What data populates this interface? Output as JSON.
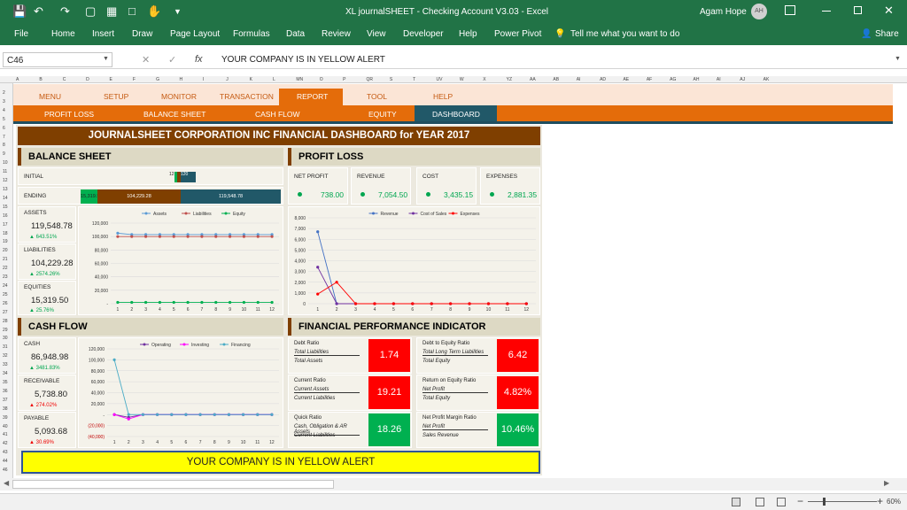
{
  "window": {
    "title": "XL journalSHEET - Checking Account V3.03  -  Excel",
    "user": "Agam Hope",
    "user_initials": "AH",
    "share": "Share"
  },
  "ribbon": {
    "tabs": [
      "File",
      "Home",
      "Insert",
      "Draw",
      "Page Layout",
      "Formulas",
      "Data",
      "Review",
      "View",
      "Developer",
      "Help",
      "Power Pivot"
    ],
    "tell_me": "Tell me what you want to do"
  },
  "formula": {
    "cell": "C46",
    "content": "YOUR COMPANY IS IN YELLOW ALERT"
  },
  "columns": [
    "A",
    "B",
    "C",
    "D",
    "E",
    "F",
    "G",
    "H",
    "I",
    "J",
    "K",
    "L",
    "MN",
    "O",
    "P",
    "QR",
    "S",
    "T",
    "UV",
    "W",
    "X",
    "YZ",
    "AA",
    "AB",
    "AI",
    "AD",
    "AE",
    "AF",
    "AG",
    "AH",
    "AI",
    "AJ",
    "AK"
  ],
  "rows": [
    "2",
    "3",
    "4",
    "5",
    "6",
    "7",
    "8",
    "9",
    "10",
    "11",
    "12",
    "13",
    "14",
    "15",
    "16",
    "17",
    "18",
    "19",
    "20",
    "21",
    "22",
    "23",
    "24",
    "25",
    "26",
    "27",
    "28",
    "29",
    "30",
    "31",
    "32",
    "33",
    "34",
    "35",
    "36",
    "37",
    "38",
    "39",
    "40",
    "41",
    "42",
    "43",
    "44",
    "46"
  ],
  "menu": [
    "MENU",
    "SETUP",
    "MONITOR",
    "TRANSACTION",
    "REPORT",
    "TOOL",
    "HELP"
  ],
  "submenu": [
    "PROFIT LOSS",
    "BALANCE SHEET",
    "CASH FLOW",
    "EQUITY",
    "DASHBOARD"
  ],
  "dashboard_title": "JOURNALSHEET CORPORATION INC FINANCIAL DASHBOARD  for YEAR 2017",
  "balance": {
    "title": "BALANCE SHEET",
    "initial_label": "INITIAL",
    "ending_label": "ENDING",
    "initial_bar_labels": [
      "12",
      "1",
      "2",
      "3",
      "120"
    ],
    "ending_bar_labels": [
      "15,319.50",
      "104,229.28",
      "119,548.78"
    ],
    "assets_label": "ASSETS",
    "assets_value": "119,548.78",
    "assets_pct": "▲ 643.51%",
    "liab_label": "LIABILITIES",
    "liab_value": "104,229.28",
    "liab_pct": "▲ 2574.26%",
    "eq_label": "EQUITIES",
    "eq_value": "15,319.50",
    "eq_pct": "▲ 25.76%"
  },
  "profit": {
    "title": "PROFIT LOSS",
    "np_label": "NET PROFIT",
    "np_value": "738.00",
    "rev_label": "REVENUE",
    "rev_value": "7,054.50",
    "cost_label": "COST",
    "cost_value": "3,435.15",
    "exp_label": "EXPENSES",
    "exp_value": "2,881.35"
  },
  "cash": {
    "title": "CASH FLOW",
    "cash_label": "CASH",
    "cash_value": "86,948.98",
    "cash_pct": "▲ 3481.83%",
    "rec_label": "RECEIVABLE",
    "rec_value": "5,738.80",
    "rec_pct": "▲ 274.02%",
    "pay_label": "PAYABLE",
    "pay_value": "5,093.68",
    "pay_pct": "▲ 30.69%"
  },
  "fpi": {
    "title": "FINANCIAL PERFORMANCE INDICATOR",
    "items": [
      {
        "name": "Debt Ratio",
        "num": "Total Liabilities",
        "den": "Total Assets",
        "value": "1.74",
        "color": "#ff0000"
      },
      {
        "name": "Debt to Equity Ratio",
        "num": "Total Long Term Liabilities",
        "den": "Total Equity",
        "value": "6.42",
        "color": "#ff0000"
      },
      {
        "name": "Current Ratio",
        "num": "Current Assets",
        "den": "Current Liabilities",
        "value": "19.21",
        "color": "#ff0000"
      },
      {
        "name": "Return on Equity Ratio",
        "num": "Net Profit",
        "den": "Total Equity",
        "value": "4.82%",
        "color": "#ff0000"
      },
      {
        "name": "Quick Ratio",
        "num": "Cash, Obligation & AR Assets",
        "den": "Current Liabilities",
        "value": "18.26",
        "color": "#00b050"
      },
      {
        "name": "Net Profit Margin Ratio",
        "num": "Net Profit",
        "den": "Sales Revenue",
        "value": "10.46%",
        "color": "#00b050"
      }
    ]
  },
  "alert": "YOUR COMPANY IS IN YELLOW ALERT",
  "status": {
    "zoom": "60%"
  },
  "chart_data": [
    {
      "type": "line",
      "x": [
        1,
        2,
        3,
        4,
        5,
        6,
        7,
        8,
        9,
        10,
        11,
        12
      ],
      "ylim": [
        0,
        120000
      ],
      "yticks": [
        "-",
        "20,000",
        "40,000",
        "60,000",
        "80,000",
        "100,000",
        "120,000"
      ],
      "series": [
        {
          "name": "Assets",
          "color": "#5b9bd5",
          "values": [
            105000,
            103000,
            103000,
            103000,
            103000,
            103000,
            103000,
            103000,
            103000,
            103000,
            103000,
            103000
          ]
        },
        {
          "name": "Liabilities",
          "color": "#c0504d",
          "values": [
            100000,
            100000,
            100000,
            100000,
            100000,
            100000,
            100000,
            100000,
            100000,
            100000,
            100000,
            100000
          ]
        },
        {
          "name": "Equity",
          "color": "#00b050",
          "values": [
            2000,
            2000,
            2000,
            2000,
            2000,
            2000,
            2000,
            2000,
            2000,
            2000,
            2000,
            2000
          ]
        }
      ]
    },
    {
      "type": "line",
      "x": [
        1,
        2,
        3,
        4,
        5,
        6,
        7,
        8,
        9,
        10,
        11,
        12
      ],
      "ylim": [
        0,
        8000
      ],
      "yticks": [
        "0",
        "1,000",
        "2,000",
        "3,000",
        "4,000",
        "5,000",
        "6,000",
        "7,000",
        "8,000"
      ],
      "series": [
        {
          "name": "Revenue",
          "color": "#4472c4",
          "values": [
            6700,
            0,
            0,
            0,
            0,
            0,
            0,
            0,
            0,
            0,
            0,
            0
          ]
        },
        {
          "name": "Cost of Sales",
          "color": "#7030a0",
          "values": [
            3400,
            0,
            0,
            0,
            0,
            0,
            0,
            0,
            0,
            0,
            0,
            0
          ]
        },
        {
          "name": "Expenses",
          "color": "#ff0000",
          "values": [
            900,
            2000,
            0,
            0,
            0,
            0,
            0,
            0,
            0,
            0,
            0,
            0
          ]
        }
      ]
    },
    {
      "type": "line",
      "x": [
        1,
        2,
        3,
        4,
        5,
        6,
        7,
        8,
        9,
        10,
        11,
        12
      ],
      "ylim": [
        -40000,
        120000
      ],
      "yticks": [
        "(40,000)",
        "(20,000)",
        "-",
        "20,000",
        "40,000",
        "60,000",
        "80,000",
        "100,000",
        "120,000"
      ],
      "series": [
        {
          "name": "Operating",
          "color": "#7030a0",
          "values": [
            0,
            -5000,
            0,
            0,
            0,
            0,
            0,
            0,
            0,
            0,
            0,
            0
          ]
        },
        {
          "name": "Investing",
          "color": "#ff00ff",
          "values": [
            0,
            -8000,
            0,
            0,
            0,
            0,
            0,
            0,
            0,
            0,
            0,
            0
          ]
        },
        {
          "name": "Financing",
          "color": "#4bacc6",
          "values": [
            100000,
            0,
            0,
            0,
            0,
            0,
            0,
            0,
            0,
            0,
            0,
            0
          ]
        }
      ]
    }
  ]
}
